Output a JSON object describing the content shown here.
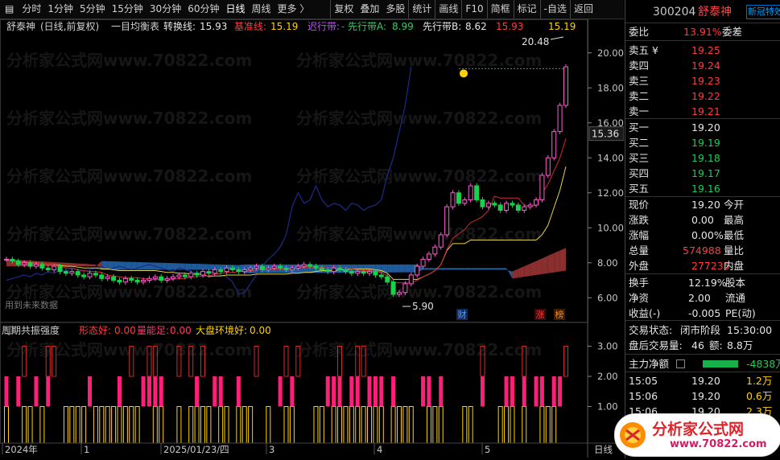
{
  "toolbar": {
    "items": [
      "分时",
      "1分钟",
      "5分钟",
      "15分钟",
      "30分钟",
      "60分钟",
      "日线",
      "周线",
      "更多 〉",
      "复权",
      "叠加",
      "多股",
      "统计",
      "画线",
      "F10",
      "简框",
      "标记",
      "-自选",
      "返回"
    ],
    "active": "日线"
  },
  "chart_header": {
    "name": "舒泰神",
    "mode": "(日线,前复权)",
    "indicator": "一目均衡表",
    "turn_label": "转换线:",
    "turn_value": "15.93",
    "base_label": "基准线:",
    "base_value": "15.19",
    "lag_label": "迟行带:",
    "lag_value": "-",
    "spanA_label": "先行带A:",
    "spanA_value": "8.99",
    "spanB_label": "先行带B:",
    "spanB_value": "8.62",
    "extra1": "15.93",
    "extra2": "15.19"
  },
  "price_axis": [
    "20.00",
    "18.00",
    "16.00",
    "14.00",
    "12.00",
    "10.00",
    "8.00",
    "6.00"
  ],
  "price_marker": "15.36",
  "annotations": {
    "high": "20.48",
    "low": "5.90",
    "future_note": "用到未来数据",
    "cai": "财",
    "zhang": "涨",
    "bang": "榜"
  },
  "sub_header": {
    "name": "周期共振强度",
    "form_label": "形态好:",
    "form_value": "0.00",
    "vol_label": "量能足:",
    "vol_value": "0.00",
    "market_label": "大盘环境好:",
    "market_value": "0.00"
  },
  "sub_axis": [
    "3.00",
    "2.00",
    "1.00"
  ],
  "date_axis": [
    "2024年",
    "1",
    "2025/01/23/四",
    "3",
    "4",
    "5"
  ],
  "date_unit": "日线",
  "watermark": "分析家公式网www.70822.com",
  "quote": {
    "code": "300204",
    "name": "舒泰神",
    "badge": "新冠特效",
    "weibi_label": "委比",
    "weibi_value": "13.91%",
    "weicha_label": "委差",
    "sell": [
      {
        "label": "卖五 ¥",
        "price": "19.25"
      },
      {
        "label": "卖四",
        "price": "19.24"
      },
      {
        "label": "卖三",
        "price": "19.23"
      },
      {
        "label": "卖二",
        "price": "19.22"
      },
      {
        "label": "卖一",
        "price": "19.21"
      }
    ],
    "buy": [
      {
        "label": "买一",
        "price": "19.20"
      },
      {
        "label": "买二",
        "price": "19.19"
      },
      {
        "label": "买三",
        "price": "19.18"
      },
      {
        "label": "买四",
        "price": "19.17"
      },
      {
        "label": "买五",
        "price": "19.16"
      }
    ],
    "stats": [
      {
        "l1": "现价",
        "v1": "19.20",
        "l2": "今开"
      },
      {
        "l1": "涨跌",
        "v1": "0.00",
        "l2": "最高"
      },
      {
        "l1": "涨幅",
        "v1": "0.00%",
        "l2": "最低"
      },
      {
        "l1": "总量",
        "v1": "574988",
        "l2": "量比"
      },
      {
        "l1": "外盘",
        "v1": "277235",
        "l2": "内盘"
      }
    ],
    "stats2": [
      {
        "l1": "换手",
        "v1": "12.19%",
        "l2": "股本"
      },
      {
        "l1": "净资",
        "v1": "2.00",
        "l2": "流通"
      },
      {
        "l1": "收益(-)",
        "v1": "-0.005",
        "l2": "PE(动)"
      }
    ],
    "trade_state_label": "交易状态:",
    "trade_state": "闭市阶段",
    "trade_time": "15:30:00",
    "after_label": "盘后交易量:",
    "after_vol": "46",
    "after_amt_label": "额:",
    "after_amt": "8.8万",
    "main_label": "主力净额",
    "main_value": "-4838万",
    "ticks": [
      {
        "time": "15:05",
        "price": "19.20",
        "vol": "1.2万"
      },
      {
        "time": "15:06",
        "price": "19.20",
        "vol": "0.6万"
      },
      {
        "time": "15:06",
        "price": "19.20",
        "vol": "2.3万"
      }
    ]
  },
  "logo": {
    "text": "分析家公式网",
    "url": "www.70822.com"
  },
  "chart_data": {
    "type": "candlestick",
    "title": "舒泰神 (日线,前复权) 一目均衡表",
    "ylim": [
      5.0,
      21.0
    ],
    "close": [
      8.2,
      8.1,
      7.9,
      8.0,
      7.8,
      7.9,
      7.7,
      7.6,
      7.8,
      7.5,
      7.4,
      7.5,
      7.3,
      7.2,
      7.4,
      7.3,
      7.1,
      7.2,
      7.0,
      6.9,
      7.1,
      7.0,
      6.9,
      7.0,
      7.1,
      7.2,
      7.0,
      7.1,
      7.2,
      7.3,
      7.2,
      7.4,
      7.3,
      7.5,
      7.4,
      7.6,
      7.5,
      7.7,
      7.6,
      7.5,
      7.6,
      7.7,
      7.8,
      7.6,
      7.7,
      7.8,
      7.7,
      7.6,
      7.7,
      7.8,
      7.9,
      7.8,
      7.7,
      7.6,
      7.5,
      7.7,
      7.6,
      7.5,
      7.4,
      7.5,
      7.4,
      7.5,
      7.3,
      7.2,
      6.9,
      6.2,
      6.3,
      6.8,
      7.3,
      7.8,
      8.2,
      8.5,
      8.9,
      9.6,
      11.2,
      12.0,
      11.4,
      11.6,
      12.4,
      11.6,
      11.2,
      11.4,
      11.3,
      11.0,
      11.4,
      11.3,
      11.0,
      11.2,
      11.3,
      11.6,
      13.0,
      14.0,
      15.5,
      17.0,
      19.2
    ],
    "ichimoku_turn": 15.93,
    "ichimoku_base": 15.19,
    "span_a": 8.99,
    "span_b": 8.62,
    "high": 20.48,
    "low": 5.9
  }
}
